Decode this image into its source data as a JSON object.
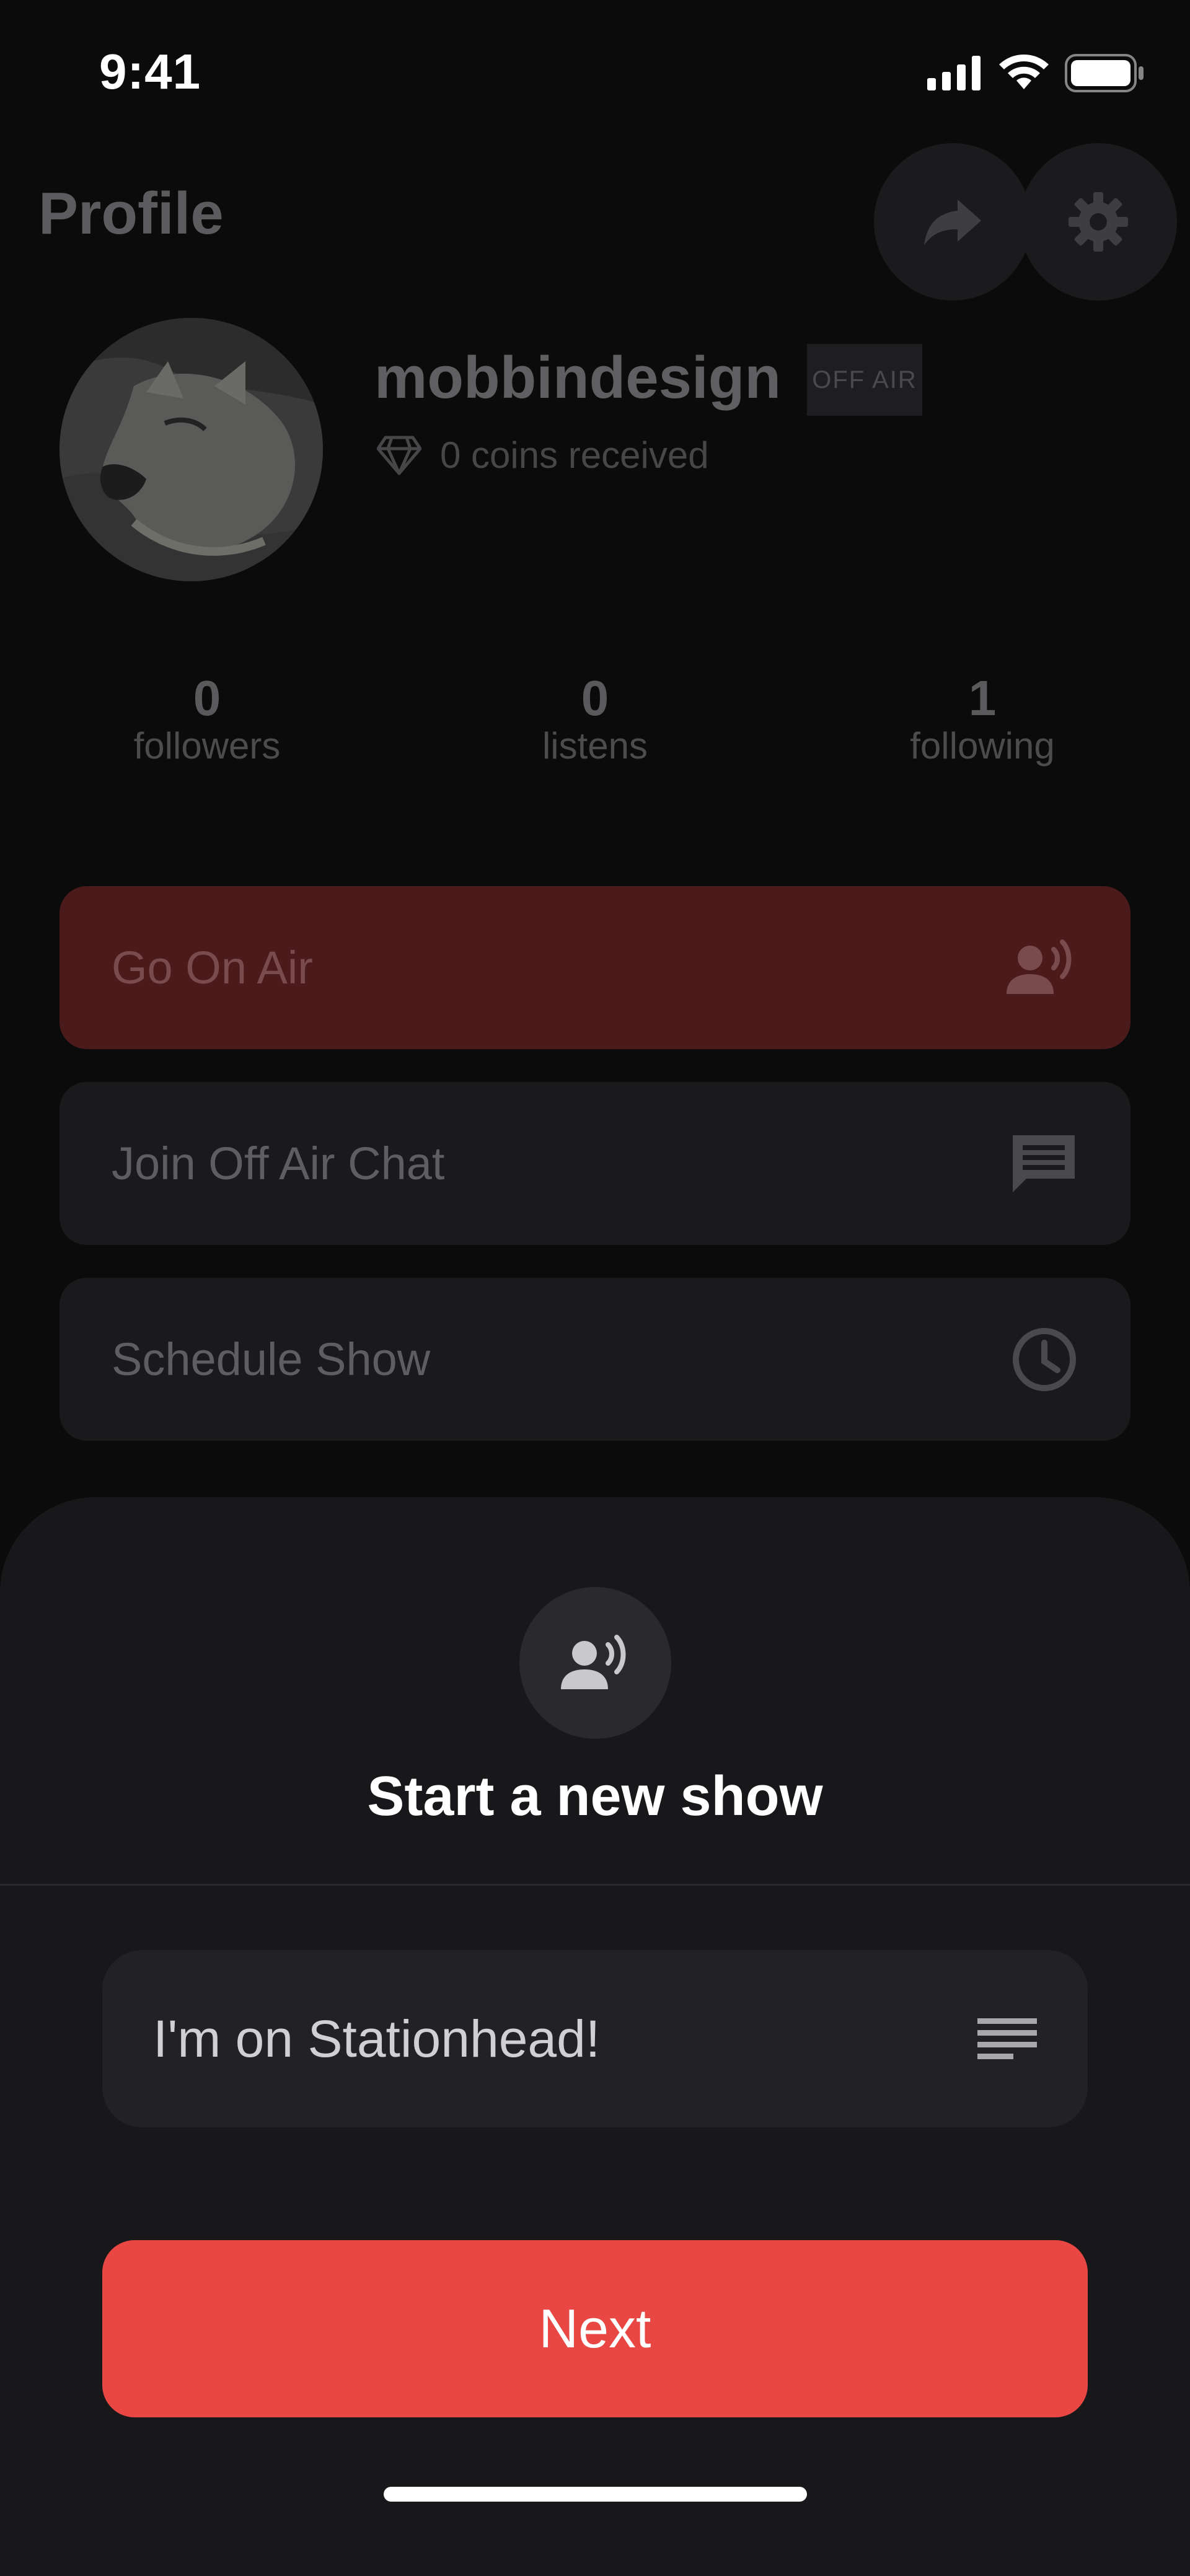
{
  "status_bar": {
    "time": "9:41"
  },
  "header": {
    "title": "Profile",
    "share_icon": "share-icon",
    "settings_icon": "gear-icon"
  },
  "profile": {
    "username": "mobbindesign",
    "status_badge": "OFF AIR",
    "coins_text": "0 coins received",
    "avatar_icon": "dog-photo-avatar"
  },
  "stats": [
    {
      "value": "0",
      "label": "followers"
    },
    {
      "value": "0",
      "label": "listens"
    },
    {
      "value": "1",
      "label": "following"
    }
  ],
  "actions": [
    {
      "label": "Go On Air",
      "icon": "broadcast-person-icon"
    },
    {
      "label": "Join Off Air Chat",
      "icon": "chat-icon"
    },
    {
      "label": "Schedule Show",
      "icon": "clock-icon"
    }
  ],
  "sheet": {
    "icon": "broadcast-person-icon",
    "title": "Start a new show",
    "show_title_value": "I'm on Stationhead!",
    "field_icon": "text-lines-icon",
    "next_label": "Next"
  },
  "colors": {
    "accent": "#e94743",
    "go_on_air_dimmed": "#4b1b1c",
    "sheet_bg": "#18181a",
    "background": "#0b0b0c"
  }
}
